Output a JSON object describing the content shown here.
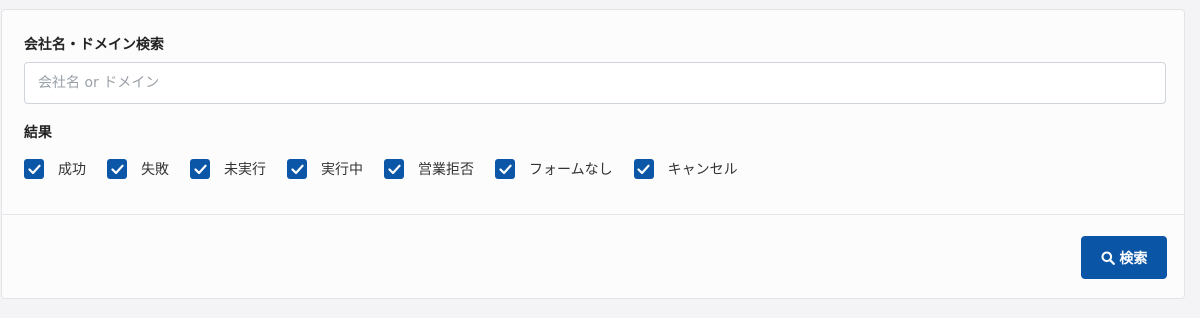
{
  "search": {
    "label": "会社名・ドメイン検索",
    "placeholder": "会社名 or ドメイン",
    "value": ""
  },
  "results": {
    "label": "結果",
    "options": [
      {
        "label": "成功",
        "checked": true
      },
      {
        "label": "失敗",
        "checked": true
      },
      {
        "label": "未実行",
        "checked": true
      },
      {
        "label": "実行中",
        "checked": true
      },
      {
        "label": "営業拒否",
        "checked": true
      },
      {
        "label": "フォームなし",
        "checked": true
      },
      {
        "label": "キャンセル",
        "checked": true
      }
    ]
  },
  "actions": {
    "search_button_label": "検索",
    "search_button_icon": "search-icon"
  },
  "colors": {
    "accent": "#0b55a6",
    "checkbox": "#0c56a8"
  }
}
